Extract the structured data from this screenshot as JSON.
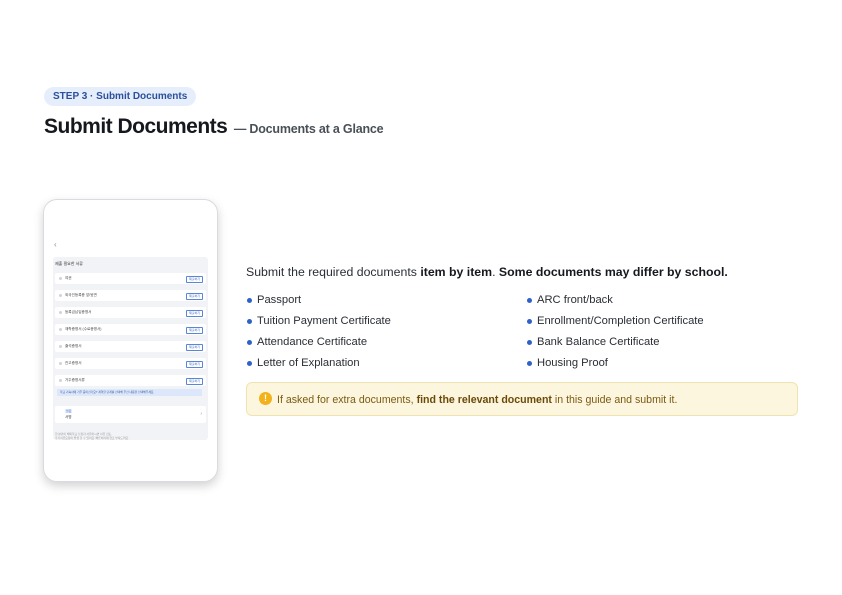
{
  "header": {
    "step_badge": "STEP 3 · Submit Documents",
    "title": "Submit Documents",
    "subtitle": "— Documents at a Glance"
  },
  "phone": {
    "section_title": "제출 필요한 서류",
    "rows": [
      {
        "label": "여권",
        "action": "제출하기"
      },
      {
        "label": "외국인등록증 앞/뒷면",
        "action": "제출하기"
      },
      {
        "label": "등록금납입증명서",
        "action": "제출하기"
      },
      {
        "label": "재학증명서 (수료증명서)",
        "action": "제출하기"
      },
      {
        "label": "출석증명서",
        "action": "제출하기"
      },
      {
        "label": "잔고증명서",
        "action": "제출하기"
      },
      {
        "label": "거주증명서류",
        "action": "제출하기"
      }
    ],
    "note": "학교 기숙사에 거주 중이신가요? 계약할 단계를 선택해 주신 내용을 선택해주세요.",
    "card_tag": "필요",
    "card_text": "서명",
    "footer_line1": "한 분만이 해외학교 신청자 서류하시면 서류 검토,",
    "footer_line2": "추가서류요청이 발생 할 수 있어요. 빠른처리에 협조 부탁드려요."
  },
  "content": {
    "intro_plain": "Submit the required documents ",
    "intro_bold1": "item by item",
    "intro_sep": ". ",
    "intro_bold2": "Some documents may differ by school.",
    "left_items": [
      "Passport",
      "Tuition Payment Certificate",
      "Attendance Certificate",
      "Letter of Explanation"
    ],
    "right_items": [
      "ARC front/back",
      "Enrollment/Completion Certificate",
      "Bank Balance Certificate",
      "Housing Proof"
    ],
    "notice_icon": "!",
    "notice_before": "If asked for extra documents, ",
    "notice_bold": "find the relevant document",
    "notice_after": " in this guide and submit it."
  },
  "colors": {
    "accent": "#2e62c9",
    "badge_bg": "#e6eefc",
    "notice_bg": "#fdf6de",
    "warning": "#f2b21b"
  },
  "icons": {
    "back": "chevron-left-icon",
    "bullet": "bullet-dot-icon",
    "notice": "warning-icon",
    "card": "chevron-right-icon"
  }
}
